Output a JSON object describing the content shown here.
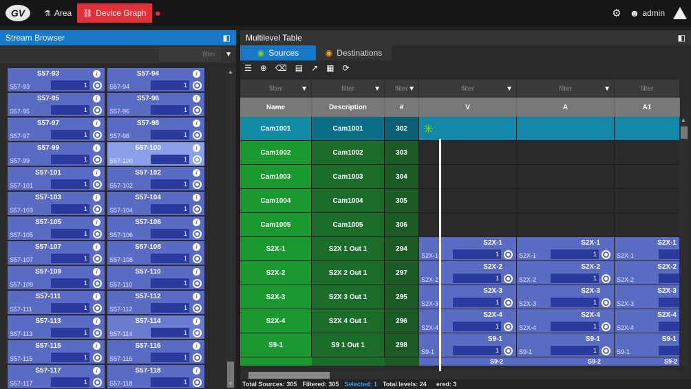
{
  "topbar": {
    "logo_text": "GV",
    "nav": [
      {
        "label": "Area",
        "icon": "area-icon"
      },
      {
        "label": "Device Graph",
        "icon": "device-graph-icon"
      }
    ],
    "user_label": "admin"
  },
  "stream_browser": {
    "title": "Stream Browser",
    "filter_placeholder": "filter",
    "cells": [
      {
        "title": "S57-93",
        "label": "S57-93",
        "value": "1"
      },
      {
        "title": "S57-94",
        "label": "S57-94",
        "value": "1"
      },
      {
        "title": "S57-95",
        "label": "S57-95",
        "value": "1"
      },
      {
        "title": "S57-96",
        "label": "S57-96",
        "value": "1"
      },
      {
        "title": "S57-97",
        "label": "S57-97",
        "value": "1"
      },
      {
        "title": "S57-98",
        "label": "S57-98",
        "value": "1"
      },
      {
        "title": "S57-99",
        "label": "S57-99",
        "value": "1"
      },
      {
        "title": "S57-100",
        "label": "S57-100",
        "value": "1",
        "selected": true
      },
      {
        "title": "S57-101",
        "label": "S57-101",
        "value": "1"
      },
      {
        "title": "S57-102",
        "label": "S57-102",
        "value": "1"
      },
      {
        "title": "S57-103",
        "label": "S57-103",
        "value": "1"
      },
      {
        "title": "S57-104",
        "label": "S57-104",
        "value": "1"
      },
      {
        "title": "S57-105",
        "label": "S57-105",
        "value": "1"
      },
      {
        "title": "S57-106",
        "label": "S57-106",
        "value": "1"
      },
      {
        "title": "S57-107",
        "label": "S57-107",
        "value": "1"
      },
      {
        "title": "S57-108",
        "label": "S57-108",
        "value": "1"
      },
      {
        "title": "S57-109",
        "label": "S57-109",
        "value": "1"
      },
      {
        "title": "S57-110",
        "label": "S57-110",
        "value": "1"
      },
      {
        "title": "S57-111",
        "label": "S57-111",
        "value": "1"
      },
      {
        "title": "S57-112",
        "label": "S57-112",
        "value": "1"
      },
      {
        "title": "S57-113",
        "label": "S57-113",
        "value": "1"
      },
      {
        "title": "S57-114",
        "label": "S57-114",
        "value": "1",
        "hover": true
      },
      {
        "title": "S57-115",
        "label": "S57-115",
        "value": "1"
      },
      {
        "title": "S57-116",
        "label": "S57-116",
        "value": "1"
      },
      {
        "title": "S57-117",
        "label": "S57-117",
        "value": "1"
      },
      {
        "title": "S57-118",
        "label": "S57-118",
        "value": "1"
      }
    ]
  },
  "multilevel": {
    "title": "Multilevel Table",
    "tabs": [
      {
        "label": "Sources",
        "active": true
      },
      {
        "label": "Destinations",
        "active": false
      }
    ],
    "filter_placeholder": "filter",
    "columns": [
      "Name",
      "Description",
      "#",
      "V",
      "A",
      "A1"
    ],
    "rows": [
      {
        "name": "Cam1001",
        "desc": "Cam1001",
        "num": "302",
        "levels": []
      },
      {
        "name": "Cam1002",
        "desc": "Cam1002",
        "num": "303",
        "levels": []
      },
      {
        "name": "Cam1003",
        "desc": "Cam1003",
        "num": "304",
        "levels": []
      },
      {
        "name": "Cam1004",
        "desc": "Cam1004",
        "num": "305",
        "levels": []
      },
      {
        "name": "Cam1005",
        "desc": "Cam1005",
        "num": "306",
        "levels": []
      },
      {
        "name": "S2X-1",
        "desc": "S2X 1 Out 1",
        "num": "294",
        "levels": [
          "S2X-1",
          "S2X-1",
          "S2X-1"
        ],
        "lv_label": "S2X-1",
        "lv_value": "1"
      },
      {
        "name": "S2X-2",
        "desc": "S2X 2 Out 1",
        "num": "297",
        "levels": [
          "S2X-2",
          "S2X-2",
          "S2X-2"
        ],
        "lv_label": "S2X-2",
        "lv_value": "1"
      },
      {
        "name": "S2X-3",
        "desc": "S2X 3 Out 1",
        "num": "295",
        "levels": [
          "S2X-3",
          "S2X-3",
          "S2X-3"
        ],
        "lv_label": "S2X-3",
        "lv_value": "1"
      },
      {
        "name": "S2X-4",
        "desc": "S2X 4 Out 1",
        "num": "296",
        "levels": [
          "S2X-4",
          "S2X-4",
          "S2X-4"
        ],
        "lv_label": "S2X-4",
        "lv_value": "1"
      },
      {
        "name": "S9-1",
        "desc": "S9 1 Out 1",
        "num": "298",
        "levels": [
          "S9-1",
          "S9-1",
          "S9-1"
        ],
        "lv_label": "S9-1",
        "lv_value": "1"
      }
    ],
    "next_row_levels": [
      "S9-2",
      "S9-2",
      "S9-2"
    ],
    "status": {
      "total_sources": "Total Sources: 305",
      "filtered": "Filtered: 305",
      "selected": "Selected: 1",
      "total_levels": "Total levels: 24",
      "filtered_levels": "ered: 3"
    }
  }
}
